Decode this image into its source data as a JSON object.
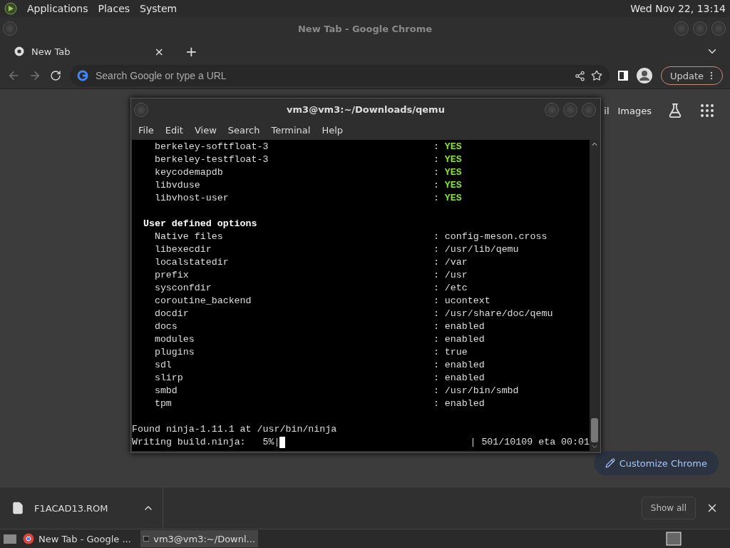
{
  "top_panel": {
    "menus": [
      "Applications",
      "Places",
      "System"
    ],
    "clock": "Wed Nov 22, 13:14"
  },
  "browser": {
    "title": "New Tab - Google Chrome",
    "tabs": [
      {
        "label": "New Tab",
        "close": "×",
        "selected": true
      }
    ],
    "new_tab": "+",
    "omnibox": {
      "placeholder": "Search Google or type a URL"
    },
    "update_button": "Update",
    "header_links": [
      "il",
      "Images"
    ],
    "customize_button": "Customize Chrome",
    "download": {
      "file": "F1ACAD13.ROM",
      "show_all": "Show all"
    }
  },
  "terminal": {
    "title": "vm3@vm3:~/Downloads/qemu",
    "menu": [
      "File",
      "Edit",
      "View",
      "Search",
      "Terminal",
      "Help"
    ],
    "lines": [
      {
        "kind": "pair",
        "name": "berkeley-softfloat-3",
        "sep": ":",
        "value": "YES",
        "highlight": true
      },
      {
        "kind": "pair",
        "name": "berkeley-testfloat-3",
        "sep": ":",
        "value": "YES",
        "highlight": true
      },
      {
        "kind": "pair",
        "name": "keycodemapdb",
        "sep": ":",
        "value": "YES",
        "highlight": true
      },
      {
        "kind": "pair",
        "name": "libvduse",
        "sep": ":",
        "value": "YES",
        "highlight": true
      },
      {
        "kind": "pair",
        "name": "libvhost-user",
        "sep": ":",
        "value": "YES",
        "highlight": true
      },
      {
        "kind": "blank"
      },
      {
        "kind": "heading",
        "text": "User defined options"
      },
      {
        "kind": "pair",
        "name": "Native files",
        "sep": ":",
        "value": "config-meson.cross",
        "highlight": false
      },
      {
        "kind": "pair",
        "name": "libexecdir",
        "sep": ":",
        "value": "/usr/lib/qemu",
        "highlight": false
      },
      {
        "kind": "pair",
        "name": "localstatedir",
        "sep": ":",
        "value": "/var",
        "highlight": false
      },
      {
        "kind": "pair",
        "name": "prefix",
        "sep": ":",
        "value": "/usr",
        "highlight": false
      },
      {
        "kind": "pair",
        "name": "sysconfdir",
        "sep": ":",
        "value": "/etc",
        "highlight": false
      },
      {
        "kind": "pair",
        "name": "coroutine_backend",
        "sep": ":",
        "value": "ucontext",
        "highlight": false
      },
      {
        "kind": "pair",
        "name": "docdir",
        "sep": ":",
        "value": "/usr/share/doc/qemu",
        "highlight": false
      },
      {
        "kind": "pair",
        "name": "docs",
        "sep": ":",
        "value": "enabled",
        "highlight": false
      },
      {
        "kind": "pair",
        "name": "modules",
        "sep": ":",
        "value": "enabled",
        "highlight": false
      },
      {
        "kind": "pair",
        "name": "plugins",
        "sep": ":",
        "value": "true",
        "highlight": false
      },
      {
        "kind": "pair",
        "name": "sdl",
        "sep": ":",
        "value": "enabled",
        "highlight": false
      },
      {
        "kind": "pair",
        "name": "slirp",
        "sep": ":",
        "value": "enabled",
        "highlight": false
      },
      {
        "kind": "pair",
        "name": "smbd",
        "sep": ":",
        "value": "/usr/bin/smbd",
        "highlight": false
      },
      {
        "kind": "pair",
        "name": "tpm",
        "sep": ":",
        "value": "enabled",
        "highlight": false
      },
      {
        "kind": "blank"
      },
      {
        "kind": "plain",
        "text": "Found ninja-1.11.1 at /usr/bin/ninja"
      },
      {
        "kind": "progress",
        "text": "Writing build.ninja:   5%|",
        "status": "| 501/10109 eta 00:01"
      }
    ]
  },
  "taskbar": {
    "items": [
      {
        "label": "New Tab - Google ...",
        "kind": "browser",
        "selected": false
      },
      {
        "label": "vm3@vm3:~/Downl...",
        "kind": "terminal",
        "selected": true
      }
    ]
  }
}
